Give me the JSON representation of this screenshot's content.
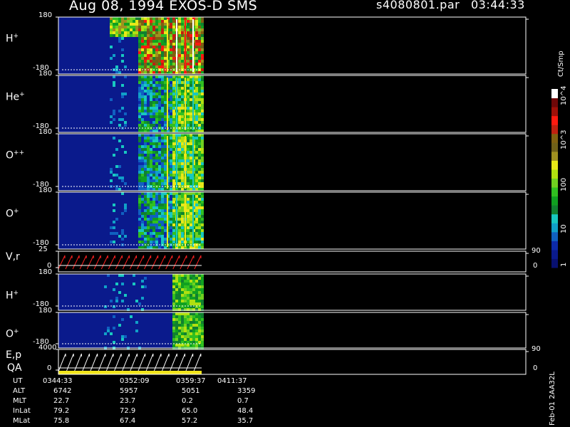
{
  "header": {
    "title": "Aug 08, 1994   EXOS-D SMS",
    "file": "s4080801.par",
    "time": "03:44:33"
  },
  "colors": {
    "background": "#000000",
    "frame": "#ffffff",
    "panel_fill": "#0a1a8c",
    "trace": "#ff2020",
    "qa_bar": "#f2e61a"
  },
  "colorbar": {
    "unit": "Ct/Smp",
    "tick_labels": [
      "1",
      "10",
      "100",
      "10^3",
      "10^4"
    ],
    "colors": [
      "#081070",
      "#0a1a8c",
      "#0c2aa8",
      "#1060c0",
      "#10a0c8",
      "#18c8c0",
      "#108030",
      "#10a020",
      "#30c020",
      "#70d020",
      "#b0e010",
      "#e8e818",
      "#a09020",
      "#706018",
      "#806010",
      "#c02010",
      "#ff1a10",
      "#a01008",
      "#700808",
      "#ffffff"
    ]
  },
  "chart_data": [
    {
      "type": "heatmap",
      "name": "H+",
      "label": "H",
      "sup": "+",
      "ylim": [
        -180,
        180
      ],
      "y_ticks": [
        "180",
        "-180"
      ]
    },
    {
      "type": "heatmap",
      "name": "He+",
      "label": "He",
      "sup": "+",
      "ylim": [
        -180,
        180
      ],
      "y_ticks": [
        "180",
        "-180"
      ]
    },
    {
      "type": "heatmap",
      "name": "O++",
      "label": "O",
      "sup": "++",
      "ylim": [
        -180,
        180
      ],
      "y_ticks": [
        "180",
        "-180"
      ]
    },
    {
      "type": "heatmap",
      "name": "O+",
      "label": "O",
      "sup": "+",
      "ylim": [
        -180,
        180
      ],
      "y_ticks": [
        "180",
        "-180"
      ]
    },
    {
      "type": "line",
      "name": "V,r",
      "label": "V,r",
      "sup": "",
      "ylim": [
        0,
        25
      ],
      "y_ticks": [
        "25",
        "0"
      ],
      "right_ticks": [
        "90",
        "0"
      ]
    },
    {
      "type": "heatmap",
      "name": "H+ (2)",
      "label": "H",
      "sup": "+",
      "ylim": [
        -180,
        180
      ],
      "y_ticks": [
        "180",
        "-180"
      ]
    },
    {
      "type": "heatmap",
      "name": "O+ (2)",
      "label": "O",
      "sup": "+",
      "ylim": [
        -180,
        180
      ],
      "y_ticks": [
        "180",
        "-180"
      ]
    },
    {
      "type": "line",
      "name": "E,p",
      "label": "E,p",
      "sup": "",
      "ylim": [
        0,
        4000
      ],
      "y_ticks": [
        "4000",
        "0"
      ],
      "right_ticks": [
        "90",
        "0"
      ]
    }
  ],
  "qa_label": "QA",
  "footer": {
    "rows": [
      {
        "label": "UT",
        "values": [
          "0344:33",
          "0352:09",
          "0359:37",
          "0411:37"
        ]
      },
      {
        "label": "ALT",
        "values": [
          "6742",
          "5957",
          "5051",
          "3359"
        ]
      },
      {
        "label": "MLT",
        "values": [
          "22.7",
          "23.7",
          "0.2",
          "0.7"
        ]
      },
      {
        "label": "InLat",
        "values": [
          "79.2",
          "72.9",
          "65.0",
          "48.4"
        ]
      },
      {
        "label": "MLat",
        "values": [
          "75.8",
          "67.4",
          "57.2",
          "35.7"
        ]
      }
    ],
    "side_text": "Feb-01 2AA32L"
  }
}
